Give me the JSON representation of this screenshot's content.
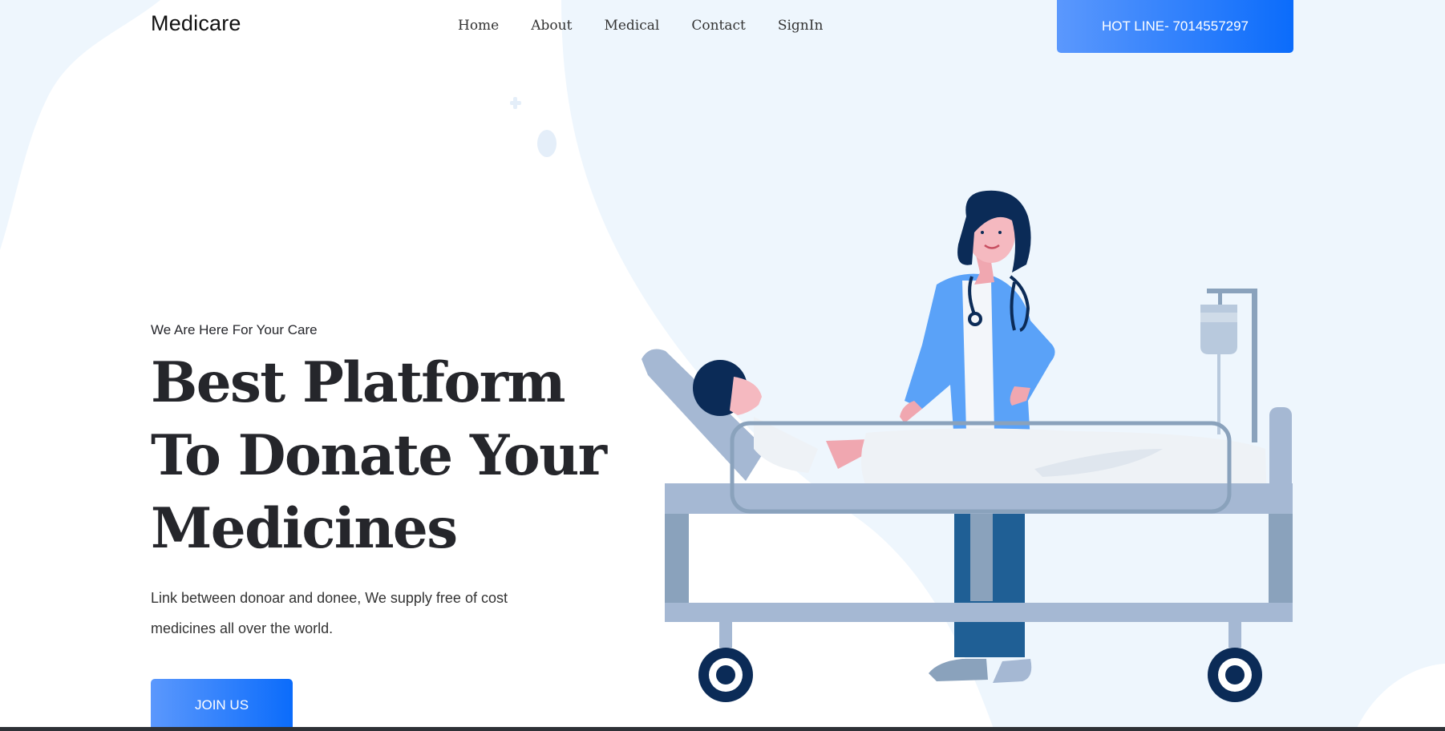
{
  "brand": {
    "name": "Medicare"
  },
  "nav": {
    "items": [
      {
        "label": "Home"
      },
      {
        "label": "About"
      },
      {
        "label": "Medical"
      },
      {
        "label": "Contact"
      },
      {
        "label": "SignIn"
      }
    ]
  },
  "header": {
    "hotline_label": "HOT LINE- 7014557297"
  },
  "hero": {
    "tagline": "We Are Here For Your Care",
    "headline_lines": [
      "Best Platform",
      "To Donate Your",
      "Medicines"
    ],
    "description_lines": [
      "Link between donoar and donee, We supply free of cost",
      "medicines all over the world."
    ],
    "cta_label": "JOIN US"
  },
  "colors": {
    "accent_start": "#5b98fd",
    "accent_end": "#0b6cfb",
    "blob": "#eef6fd",
    "navy": "#0b2b57"
  },
  "icons": [
    "plus-icon",
    "oval-icon"
  ]
}
